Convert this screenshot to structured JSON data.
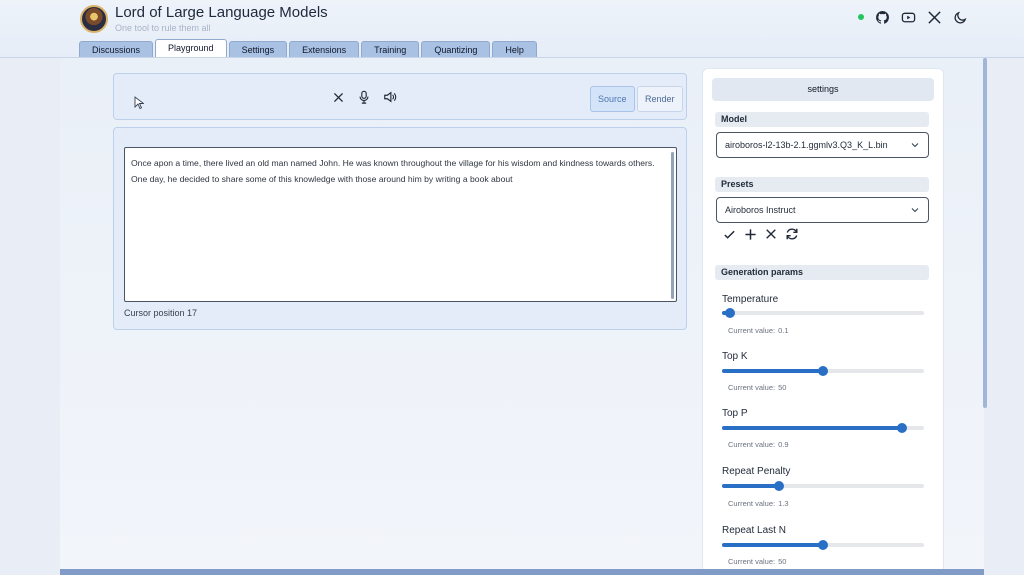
{
  "app": {
    "title": "Lord of Large Language Models",
    "subtitle": "One tool to rule them all"
  },
  "header_icons": [
    "status-dot",
    "github-icon",
    "youtube-icon",
    "x-icon",
    "moon-icon"
  ],
  "tabs": [
    {
      "label": "Discussions",
      "active": false
    },
    {
      "label": "Playground",
      "active": true
    },
    {
      "label": "Settings",
      "active": false
    },
    {
      "label": "Extensions",
      "active": false
    },
    {
      "label": "Training",
      "active": false
    },
    {
      "label": "Quantizing",
      "active": false
    },
    {
      "label": "Help",
      "active": false
    }
  ],
  "toolbar": {
    "icons": [
      "close-icon",
      "microphone-icon",
      "speaker-icon"
    ],
    "source_label": "Source",
    "render_label": "Render"
  },
  "editor": {
    "text": "Once apon a time, there lived an old man named John. He was known throughout the village for his wisdom and kindness towards others. One day, he decided to share some of this knowledge with those around him by writing a book about",
    "cursor_label": "Cursor position",
    "cursor_value": "17"
  },
  "settings": {
    "title": "settings",
    "model_label": "Model",
    "model_value": "airoboros-l2-13b-2.1.ggmlv3.Q3_K_L.bin",
    "presets_label": "Presets",
    "preset_value": "Airoboros Instruct",
    "preset_actions": [
      "check-icon",
      "plus-icon",
      "close-icon",
      "refresh-icon"
    ],
    "gen_params_label": "Generation params",
    "current_value_label": "Current value:",
    "params": [
      {
        "label": "Temperature",
        "value": "0.1",
        "fraction": 0.04
      },
      {
        "label": "Top K",
        "value": "50",
        "fraction": 0.5
      },
      {
        "label": "Top P",
        "value": "0.9",
        "fraction": 0.89
      },
      {
        "label": "Repeat Penalty",
        "value": "1.3",
        "fraction": 0.28
      },
      {
        "label": "Repeat Last N",
        "value": "50",
        "fraction": 0.5
      }
    ]
  },
  "colors": {
    "accent": "#2a6fc6",
    "status": "#22c55e",
    "tab": "#a9c1e3"
  }
}
